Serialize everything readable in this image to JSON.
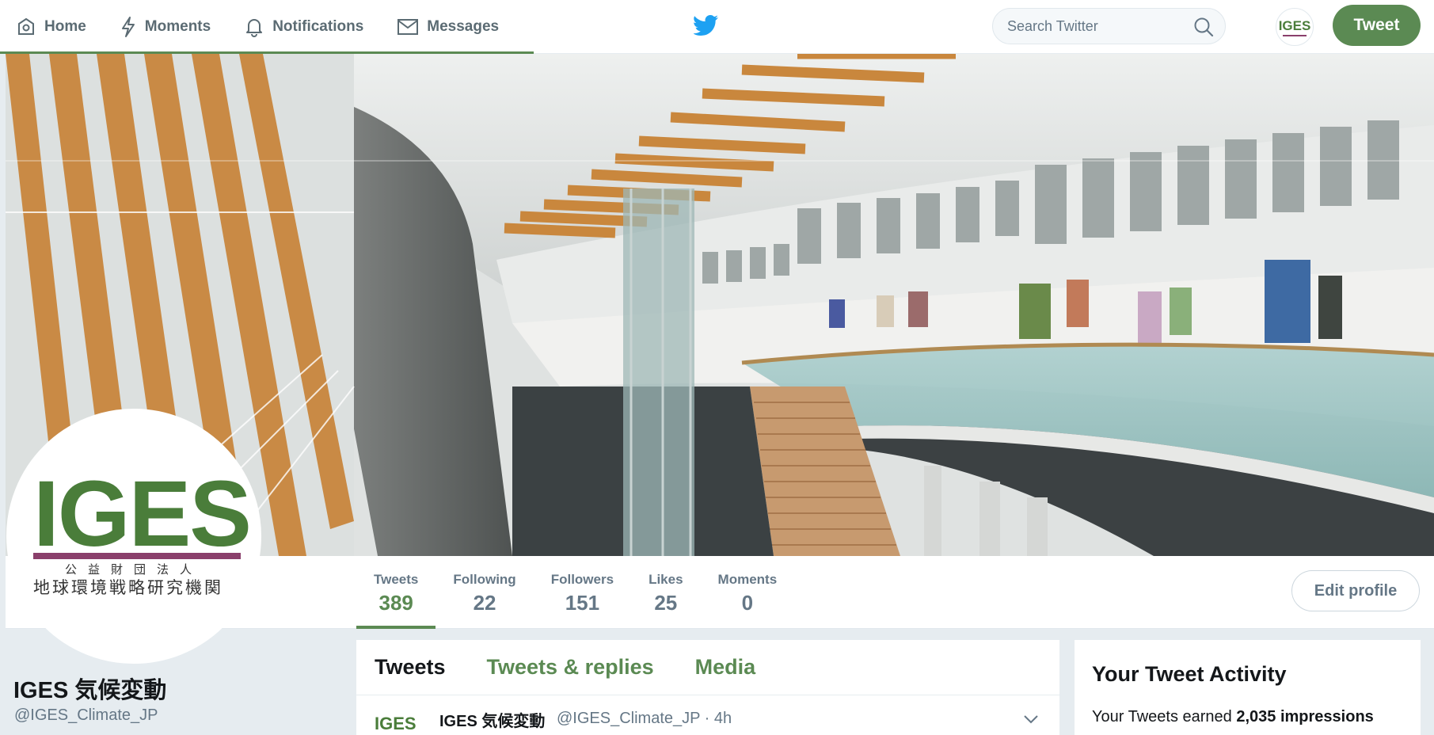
{
  "nav": {
    "items": [
      {
        "label": "Home",
        "icon": "home-icon"
      },
      {
        "label": "Moments",
        "icon": "lightning-icon"
      },
      {
        "label": "Notifications",
        "icon": "bell-icon"
      },
      {
        "label": "Messages",
        "icon": "envelope-icon"
      }
    ],
    "logo_icon": "twitter-bird-icon"
  },
  "search": {
    "placeholder": "Search Twitter"
  },
  "user_avatar_text": "IGES",
  "tweet_button_label": "Tweet",
  "profile_avatar": {
    "logo": "IGES",
    "jp_line1": "公益財団法人",
    "jp_line2": "地球環境戦略研究機関"
  },
  "stats": [
    {
      "label": "Tweets",
      "value": "389"
    },
    {
      "label": "Following",
      "value": "22"
    },
    {
      "label": "Followers",
      "value": "151"
    },
    {
      "label": "Likes",
      "value": "25"
    },
    {
      "label": "Moments",
      "value": "0"
    }
  ],
  "edit_profile_label": "Edit profile",
  "profile": {
    "name": "IGES 気候変動",
    "handle": "@IGES_Climate_JP"
  },
  "timeline": {
    "tabs": [
      "Tweets",
      "Tweets & replies",
      "Media"
    ],
    "tweet": {
      "name": "IGES 気候変動",
      "meta": "@IGES_Climate_JP · 4h",
      "logo": "IGES"
    }
  },
  "activity": {
    "title": "Your Tweet Activity",
    "text_prefix": "Your Tweets earned ",
    "impressions": "2,035 impressions"
  },
  "colors": {
    "accent": "#5b8a53",
    "brand_purple": "#8a3f6b",
    "twitter_blue": "#1da1f2"
  }
}
